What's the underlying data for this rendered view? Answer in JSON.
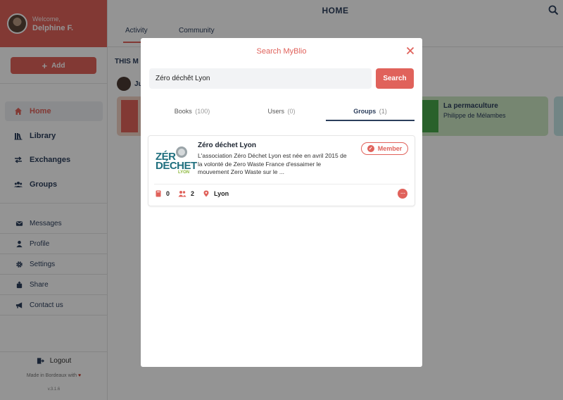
{
  "sidebar": {
    "welcome": "Welcome,",
    "user_name": "Delphine F.",
    "add_label": "Add",
    "nav": [
      {
        "label": "Home",
        "icon": "home-icon",
        "active": true
      },
      {
        "label": "Library",
        "icon": "library-icon"
      },
      {
        "label": "Exchanges",
        "icon": "exchange-icon"
      },
      {
        "label": "Groups",
        "icon": "groups-icon"
      }
    ],
    "secondary": [
      {
        "label": "Messages",
        "icon": "envelope-icon"
      },
      {
        "label": "Profile",
        "icon": "user-icon"
      },
      {
        "label": "Settings",
        "icon": "gear-icon"
      },
      {
        "label": "Share",
        "icon": "share-icon"
      },
      {
        "label": "Contact us",
        "icon": "megaphone-icon"
      }
    ],
    "logout": "Logout",
    "made_in": "Made in Bordeaux with",
    "version": "v.3.1.6"
  },
  "main": {
    "title": "HOME",
    "tabs": [
      "Activity",
      "Community"
    ],
    "section_title": "THIS M",
    "feed_user": "Ju",
    "book": {
      "title": "La permaculture",
      "author": "Philippe de Mélambes"
    }
  },
  "modal": {
    "title": "Search MyBlio",
    "query": "Zéro déchêt Lyon",
    "search_button": "Search",
    "tabs": [
      {
        "label": "Books",
        "count": "(100)"
      },
      {
        "label": "Users",
        "count": "(0)"
      },
      {
        "label": "Groups",
        "count": "(1)",
        "active": true
      }
    ],
    "result": {
      "name": "Zéro déchet Lyon",
      "description": "L'association Zéro Déchet Lyon est née en avril 2015 de la volonté de Zero Waste France d'essaimer le mouvement Zero Waste sur le ...",
      "badge": "Member",
      "books": "0",
      "members": "2",
      "location": "Lyon",
      "logo": {
        "line1": "ZÉR",
        "line2": "DÉCHET",
        "line3": "LYON"
      }
    }
  },
  "colors": {
    "accent": "#e0625b",
    "navy": "#2c3e5c"
  }
}
